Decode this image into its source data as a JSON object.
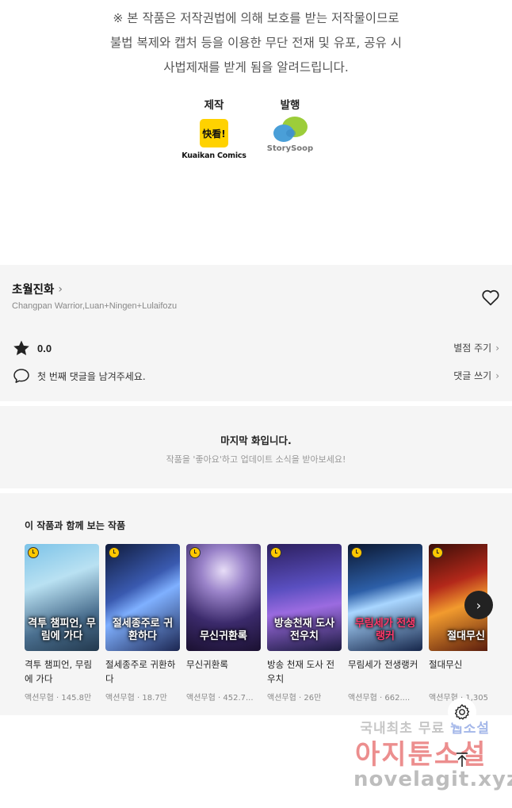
{
  "copyright": {
    "lines": [
      "※ 본 작품은 저작권법에 의해 보호를 받는 저작물이므로",
      "불법 복제와 캡처 등을  이용한 무단 전재 및 유포, 공유 시",
      "사법제재를  받게 됨을 알려드립니다."
    ]
  },
  "credits": {
    "maker_label": "제작",
    "maker_logo_text": "快看!",
    "maker_name": "Kuaikan Comics",
    "publisher_label": "발행",
    "publisher_name": "StorySoop"
  },
  "work": {
    "title": "초월진화",
    "authors": "Changpan Warrior,Luan+Ningen+Lulaifozu",
    "rating": "0.0",
    "rate_link": "별점 주기",
    "comment_prompt": "첫 번째 댓글을 남겨주세요.",
    "comment_link": "댓글 쓰기"
  },
  "last_episode": {
    "title": "마지막 화입니다.",
    "subtitle": "작품을 '좋아요'하고 업데이트 소식을 받아보세요!"
  },
  "recommendations": {
    "title": "이 작품과 함께 보는 작품",
    "items": [
      {
        "title": "격투 챔피언, 무림에 가다",
        "genre": "액션무협",
        "views": "145.8만",
        "cover_text": "격투 챔피언, 무림에 가다"
      },
      {
        "title": "절세종주로 귀환하다",
        "genre": "액션무협",
        "views": "18.7만",
        "cover_text": "절세종주로 귀환하다"
      },
      {
        "title": "무신귀환록",
        "genre": "액션무협",
        "views": "452.7...",
        "cover_text": "무신귀환록"
      },
      {
        "title": "방송 천재 도사 전우치",
        "genre": "액션무협",
        "views": "26만",
        "cover_text": "방송천재 도사 전우치"
      },
      {
        "title": "무림세가 전생랭커",
        "genre": "액션무협",
        "views": "662....",
        "cover_text": "무림세가 전생랭커"
      },
      {
        "title": "절대무신",
        "genre": "액션무협",
        "views": "1,305",
        "cover_text": "절대무신"
      }
    ],
    "meta_separator": "·"
  },
  "watermark": {
    "line1_prefix": "국내최초 무료 ",
    "line1_highlight": "웹소설",
    "line2": "아지툰소설",
    "line3": "novelagit.xyz"
  },
  "colors": {
    "panel_bg": "#f5f5f5",
    "kuaikan_yellow": "#ffd200",
    "clock_badge": "#ffc700"
  }
}
